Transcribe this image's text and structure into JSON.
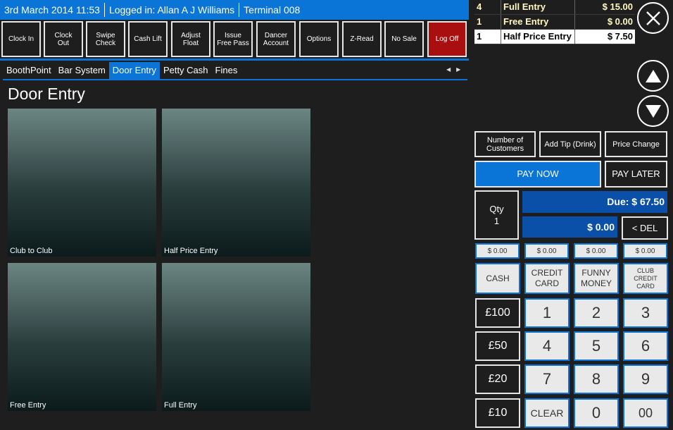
{
  "header": {
    "datetime": "3rd March 2014 11:53",
    "logged_in": "Logged in: Allan A J Williams",
    "terminal": "Terminal 008"
  },
  "toolbar": [
    "Clock In",
    "Clock\nOut",
    "Swipe\nCheck",
    "Cash Lift",
    "Adjust\nFloat",
    "Issue\nFree Pass",
    "Dancer\nAccount",
    "Options",
    "Z-Read",
    "No Sale",
    "Log Off"
  ],
  "tabs": [
    "BoothPoint",
    "Bar System",
    "Door Entry",
    "Petty Cash",
    "Fines"
  ],
  "page_title": "Door Entry",
  "tiles": [
    "Club to Club",
    "Half Price Entry",
    "Free Entry",
    "Full Entry"
  ],
  "order": [
    {
      "qty": "4",
      "desc": "Full Entry",
      "price": "$ 15.00"
    },
    {
      "qty": "1",
      "desc": "Free Entry",
      "price": "$ 0.00"
    },
    {
      "qty": "1",
      "desc": "Half Price Entry",
      "price": "$ 7.50"
    }
  ],
  "actions": {
    "customers": "Number of\nCustomers",
    "tip": "Add Tip (Drink)",
    "price_change": "Price Change",
    "pay_now": "PAY NOW",
    "pay_later": "PAY LATER"
  },
  "qty": {
    "label": "Qty",
    "value": "1"
  },
  "due": "Due: $ 67.50",
  "entered": "$ 0.00",
  "del": "< DEL",
  "tenders": [
    {
      "amount": "$ 0.00",
      "label": "CASH"
    },
    {
      "amount": "$ 0.00",
      "label": "CREDIT\nCARD"
    },
    {
      "amount": "$ 0.00",
      "label": "FUNNY\nMONEY"
    },
    {
      "amount": "$ 0.00",
      "label": "CLUB\nCREDIT\nCARD"
    }
  ],
  "quick": [
    "£100",
    "£50",
    "£20",
    "£10"
  ],
  "keypad": [
    "1",
    "2",
    "3",
    "4",
    "5",
    "6",
    "7",
    "8",
    "9",
    "CLEAR",
    "0",
    "00"
  ]
}
